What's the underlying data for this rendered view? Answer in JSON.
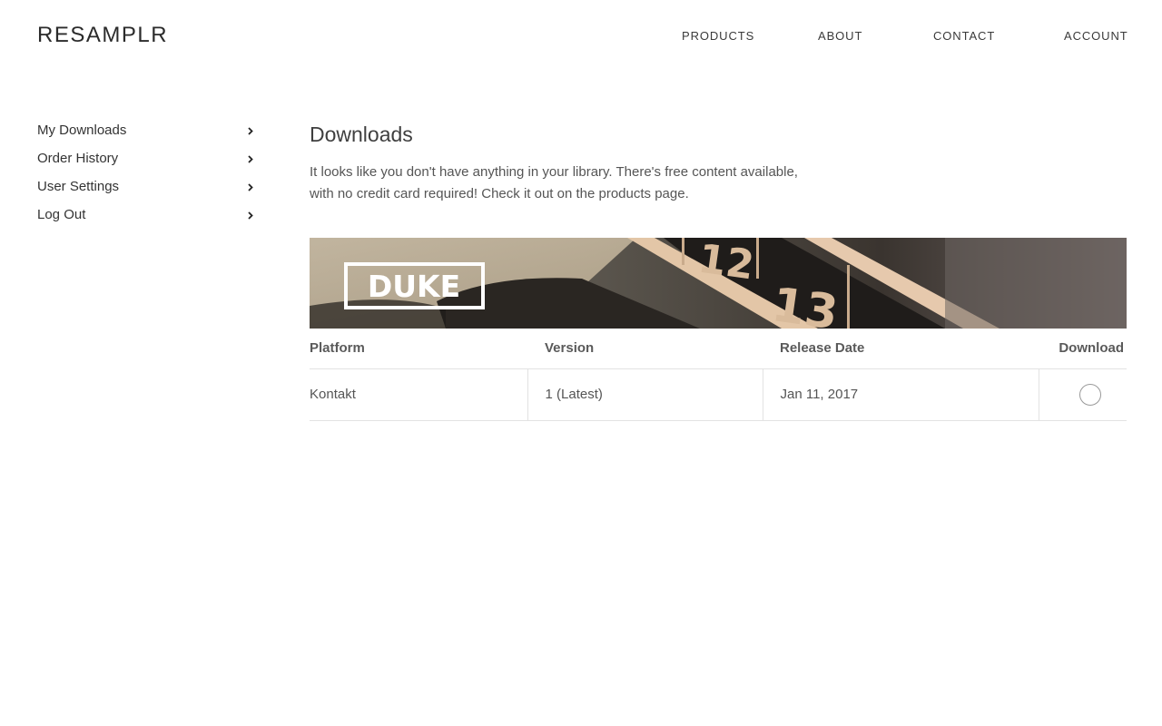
{
  "header": {
    "logo": "RESAMPLR",
    "nav": {
      "products": "PRODUCTS",
      "about": "ABOUT",
      "contact": "CONTACT",
      "account": "ACCOUNT"
    }
  },
  "sidebar": {
    "items": [
      {
        "label": "My Downloads",
        "icon": "chevron-right-icon"
      },
      {
        "label": "Order History",
        "icon": "chevron-right-icon"
      },
      {
        "label": "User Settings",
        "icon": "chevron-right-icon"
      },
      {
        "label": "Log Out",
        "icon": "chevron-right-icon"
      }
    ]
  },
  "main": {
    "title": "Downloads",
    "intro": "It looks like you don't have anything in your library.  There's free content available, with no credit card required!  Check it out on the products page.",
    "product": {
      "banner_title": "DUKE",
      "banner_digits": [
        "12",
        "13"
      ]
    },
    "table": {
      "headers": [
        "Platform",
        "Version",
        "Release Date",
        "Download"
      ],
      "rows": [
        {
          "platform": "Kontakt",
          "version": "1 (Latest)",
          "release_date": "Jan 11, 2017"
        }
      ]
    }
  },
  "colors": {
    "text": "#4a4a4a",
    "border": "#e2e2e2",
    "banner_dark": "#2a2622",
    "banner_accent": "#e6c9ad"
  }
}
